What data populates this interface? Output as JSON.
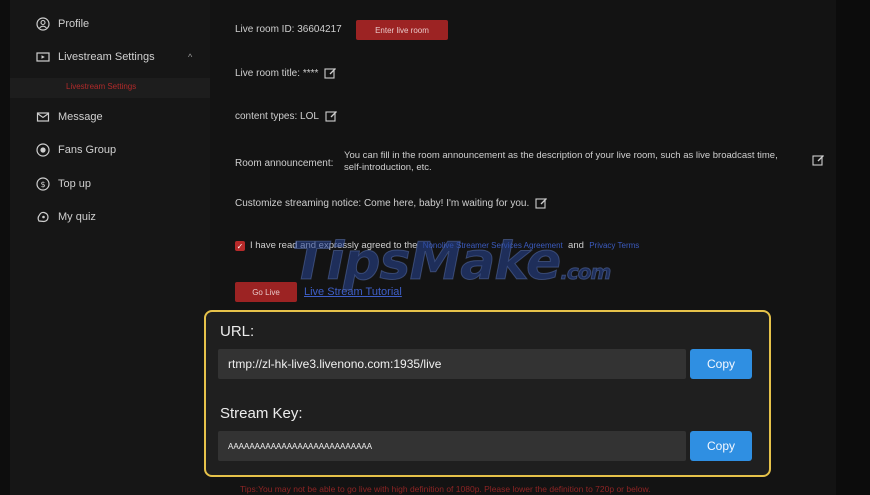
{
  "sidebar": {
    "items": [
      {
        "label": "Profile",
        "icon": "profile-icon"
      },
      {
        "label": "Livestream Settings",
        "icon": "livestream-icon"
      },
      {
        "label": "Message",
        "icon": "message-icon"
      },
      {
        "label": "Fans Group",
        "icon": "fans-group-icon"
      },
      {
        "label": "Top up",
        "icon": "top-up-icon"
      },
      {
        "label": "My quiz",
        "icon": "my-quiz-icon"
      }
    ],
    "sub_item": "Livestream Settings",
    "caret": "^"
  },
  "main": {
    "room_id_label": "Live room ID:",
    "room_id": "36604217",
    "enter_button": "Enter live room",
    "title_label": "Live room title:",
    "title_value": "****",
    "content_label": "content types:",
    "content_value": "LOL",
    "announcement_label": "Room announcement:",
    "announcement_text": "You can fill in the room announcement as the description of your live room, such as live broadcast time, self-introduction, etc.",
    "notice_label": "Customize streaming notice:",
    "notice_value": "Come here, baby! I'm waiting for you.",
    "agree_text": "I have read and expressly agreed to the",
    "agree_link_1": "Nonolive Streamer Services Agreement",
    "agree_and": "and",
    "agree_link_2": "Privacy Terms",
    "go_live_button": "Go Live",
    "tutorial_link": "Live Stream Tutorial",
    "tips": "Tips:You may not be able to go live with high definition of 1080p. Please lower the definition to 720p or below."
  },
  "panel": {
    "url_label": "URL:",
    "url_value": "rtmp://zl-hk-live3.livenono.com:1935/live",
    "key_label": "Stream Key:",
    "key_value": "AAAAAAAAAAAAAAAAAAAAAAAAAAA",
    "copy_label": "Copy"
  },
  "watermark": {
    "text": "TipsMake",
    "suffix": ".com"
  },
  "colors": {
    "accent_red": "#9c2323",
    "copy_blue": "#2f8fe2",
    "highlight_yellow": "#e6c24a",
    "link_blue": "#3b5bbf"
  }
}
